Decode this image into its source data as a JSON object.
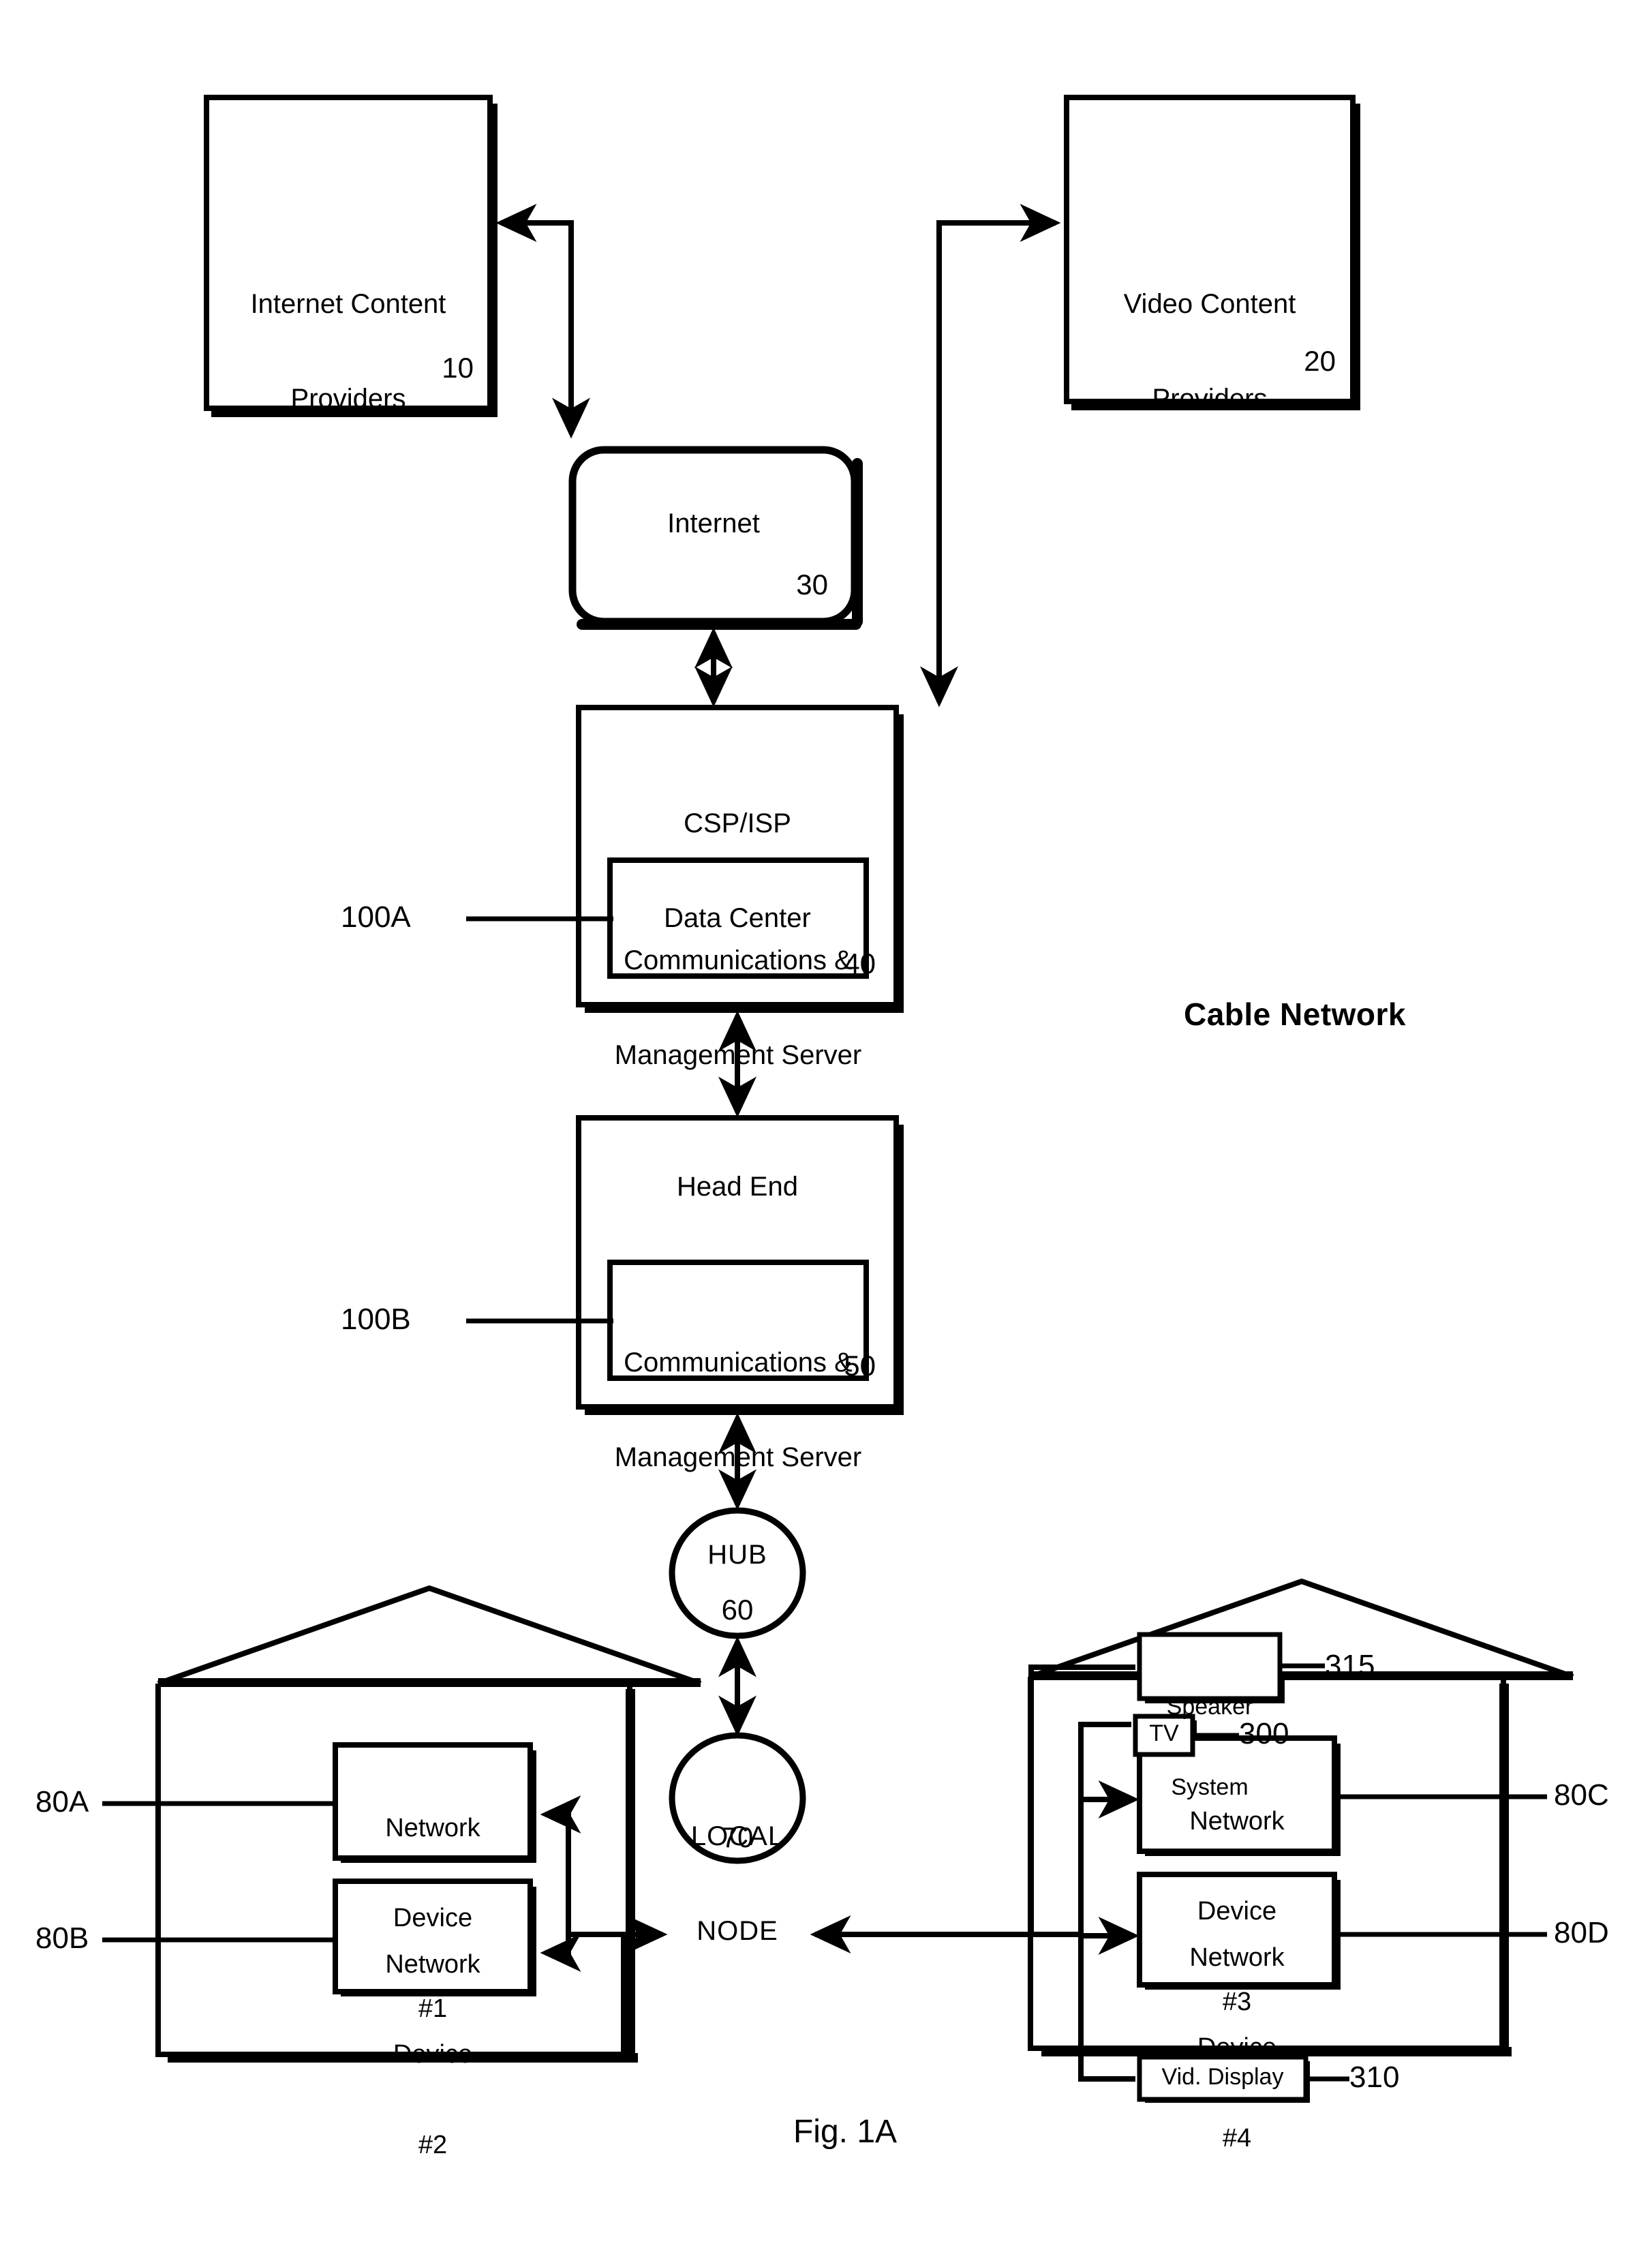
{
  "figure": {
    "caption": "Fig. 1A",
    "section_label": "Cable Network"
  },
  "nodes": {
    "internet_content_providers": {
      "label": "Internet Content\nProviders",
      "ref": "10"
    },
    "video_content_providers": {
      "label": "Video Content\nProviders",
      "ref": "20"
    },
    "internet": {
      "label": "Internet",
      "ref": "30"
    },
    "csp_isp_data_center": {
      "label": "CSP/ISP\nData Center",
      "ref": "40"
    },
    "csp_server": {
      "label": "Communications &\nManagement Server",
      "ref": "100A"
    },
    "head_end": {
      "label": "Head End",
      "ref": "50"
    },
    "head_end_server": {
      "label": "Communications &\nManagement Server",
      "ref": "100B"
    },
    "hub": {
      "label": "HUB",
      "ref": "60"
    },
    "local_node": {
      "label": "LOCAL\nNODE",
      "ref": "70"
    },
    "network_device_1": {
      "label": "Network\nDevice\n#1",
      "ref": "80A"
    },
    "network_device_2": {
      "label": "Network\nDevice\n#2",
      "ref": "80B"
    },
    "network_device_3": {
      "label": "Network\nDevice\n#3",
      "ref": "80C"
    },
    "network_device_4": {
      "label": "Network\nDevice\n#4",
      "ref": "80D"
    },
    "speaker_system": {
      "label": "Speaker\nSystem",
      "ref": "315"
    },
    "tv": {
      "label": "TV",
      "ref": "300"
    },
    "video_display": {
      "label": "Vid. Display",
      "ref": "310"
    }
  },
  "text_lines": {
    "icp_line1": "Internet Content",
    "icp_line2": "Providers",
    "vcp_line1": "Video Content",
    "vcp_line2": "Providers",
    "internet": "Internet",
    "csp_line1": "CSP/ISP",
    "csp_line2": "Data Center",
    "server_line1": "Communications &",
    "server_line2": "Management Server",
    "headend": "Head End",
    "hub": "HUB",
    "local_line1": "LOCAL",
    "local_line2": "NODE",
    "nd_line1": "Network",
    "nd_line2": "Device",
    "nd1_line3": "#1",
    "nd2_line3": "#2",
    "nd3_line3": "#3",
    "nd4_line3": "#4",
    "speaker_line1": "Speaker",
    "speaker_line2": "System",
    "tv": "TV",
    "viddisp": "Vid. Display"
  },
  "colors": {
    "ink": "#000000",
    "paper": "#ffffff"
  }
}
